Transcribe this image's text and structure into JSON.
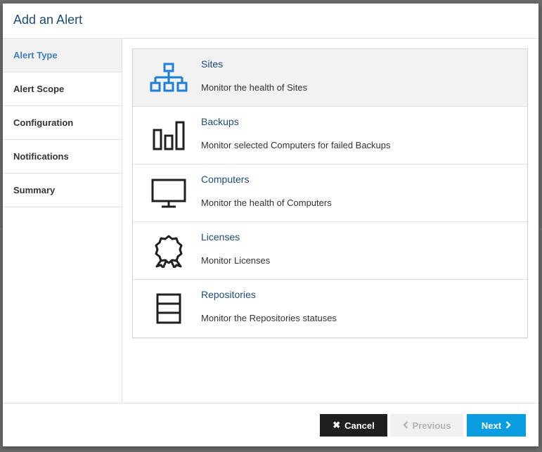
{
  "dialog": {
    "title": "Add an Alert"
  },
  "steps": [
    {
      "label": "Alert Type",
      "active": true
    },
    {
      "label": "Alert Scope",
      "active": false
    },
    {
      "label": "Configuration",
      "active": false
    },
    {
      "label": "Notifications",
      "active": false
    },
    {
      "label": "Summary",
      "active": false
    }
  ],
  "alert_types": [
    {
      "name": "Sites",
      "description": "Monitor the health of Sites",
      "icon": "sitemap-icon",
      "selected": true
    },
    {
      "name": "Backups",
      "description": "Monitor selected Computers for failed Backups",
      "icon": "bar-chart-icon",
      "selected": false
    },
    {
      "name": "Computers",
      "description": "Monitor the health of Computers",
      "icon": "monitor-icon",
      "selected": false
    },
    {
      "name": "Licenses",
      "description": "Monitor Licenses",
      "icon": "award-ribbon-icon",
      "selected": false
    },
    {
      "name": "Repositories",
      "description": "Monitor the Repositories statuses",
      "icon": "storage-stack-icon",
      "selected": false
    }
  ],
  "footer": {
    "cancel_label": "Cancel",
    "previous_label": "Previous",
    "next_label": "Next"
  },
  "colors": {
    "title": "#1e4b7a",
    "active_step": "#3d7fc1",
    "selected_icon": "#1e7fd6",
    "next_button": "#0a9ee0",
    "cancel_button": "#1f1f1f"
  }
}
